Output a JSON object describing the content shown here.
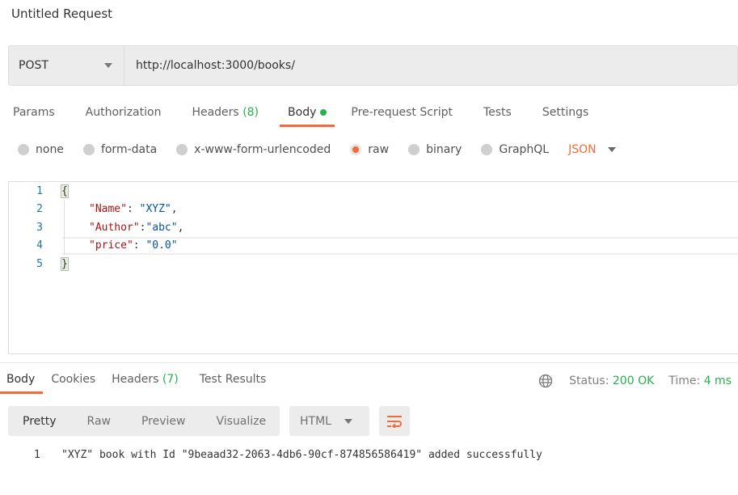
{
  "title": "Untitled Request",
  "request": {
    "method": "POST",
    "url": "http://localhost:3000/books/"
  },
  "request_tabs": [
    {
      "label": "Params"
    },
    {
      "label": "Authorization"
    },
    {
      "label": "Headers",
      "count": "(8)"
    },
    {
      "label": "Body"
    },
    {
      "label": "Pre-request Script"
    },
    {
      "label": "Tests"
    },
    {
      "label": "Settings"
    }
  ],
  "body_types": [
    {
      "label": "none"
    },
    {
      "label": "form-data"
    },
    {
      "label": "x-www-form-urlencoded"
    },
    {
      "label": "raw",
      "selected": true
    },
    {
      "label": "binary"
    },
    {
      "label": "GraphQL"
    }
  ],
  "body_format": "JSON",
  "editor": {
    "lines": [
      "1",
      "2",
      "3",
      "4",
      "5"
    ],
    "open": "{",
    "close": "}",
    "l2": {
      "key": "\"Name\"",
      "sep": ": ",
      "val": "\"XYZ\"",
      "end": ","
    },
    "l3": {
      "key": "\"Author\"",
      "sep": ":",
      "val": "\"abc\"",
      "end": ","
    },
    "l4": {
      "key": "\"price\"",
      "sep": ": ",
      "val": "\"0.0\""
    }
  },
  "response_tabs": [
    {
      "label": "Body"
    },
    {
      "label": "Cookies"
    },
    {
      "label": "Headers",
      "count": "(7)"
    },
    {
      "label": "Test Results"
    }
  ],
  "status": {
    "label": "Status:",
    "value": "200 OK",
    "time_label": "Time:",
    "time": "4 ms"
  },
  "view_modes": [
    "Pretty",
    "Raw",
    "Preview",
    "Visualize"
  ],
  "response_format": "HTML",
  "response": {
    "line": "1",
    "text": "\"XYZ\" book with Id \"9beaad32-2063-4db6-90cf-874856586419\" added successfully"
  },
  "colors": {
    "accent": "#f26b3a",
    "success": "#26b14d"
  }
}
